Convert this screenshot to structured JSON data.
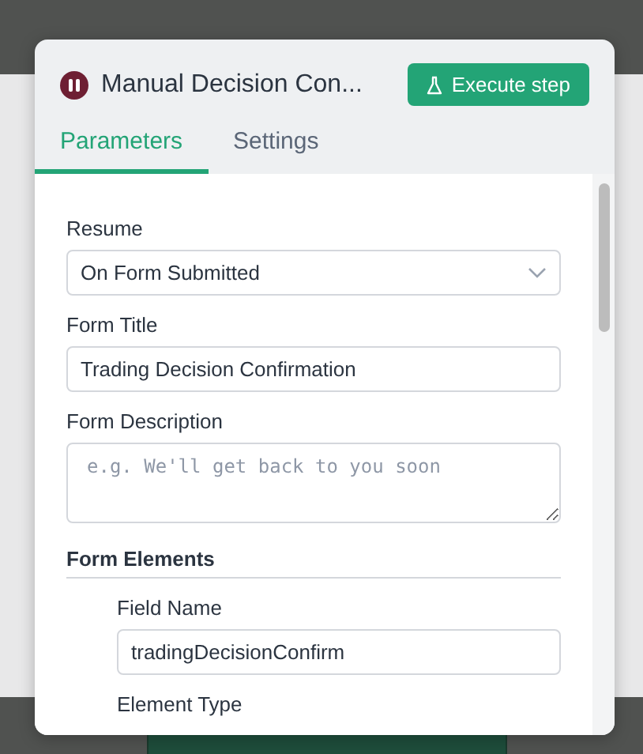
{
  "dialog": {
    "title": "Manual Decision Con...",
    "execute_button": "Execute step"
  },
  "tabs": [
    {
      "label": "Parameters",
      "selected": true
    },
    {
      "label": "Settings",
      "selected": false
    }
  ],
  "fields": [
    {
      "kind": "select",
      "label": "Resume",
      "value": "On Form Submitted"
    },
    {
      "kind": "text",
      "label": "Form Title",
      "value": "Trading Decision Confirmation"
    },
    {
      "kind": "textarea",
      "label": "Form Description",
      "placeholder": "e.g. We'll get back to you soon"
    }
  ],
  "form_elements": {
    "heading": "Form Elements",
    "fields": [
      {
        "kind": "text",
        "label": "Field Name",
        "value": "tradingDecisionConfirm"
      },
      {
        "kind": "label",
        "label": "Element Type"
      }
    ]
  }
}
